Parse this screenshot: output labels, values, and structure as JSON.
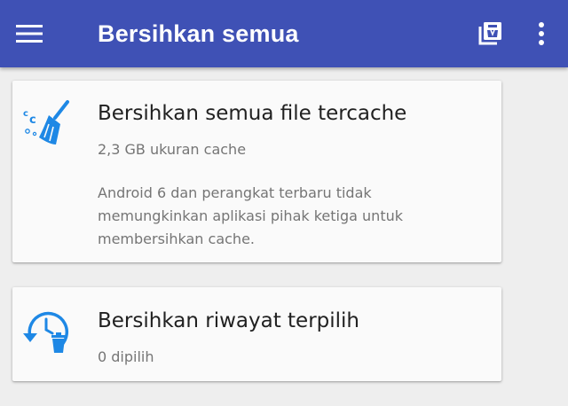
{
  "appbar": {
    "title": "Bersihkan semua",
    "background_color": "#3f51b5",
    "menu_icon": "hamburger-menu-icon",
    "action_icon": "cached-apps-list-icon",
    "overflow_icon": "more-vert-icon"
  },
  "cards": [
    {
      "icon": "broom-clean-cache-icon",
      "title": "Bersihkan semua file tercache",
      "subtitle": "2,3 GB ukuran cache",
      "description_lines": [
        "Android 6 dan perangkat terbaru tidak",
        "memungkinkan aplikasi pihak ketiga untuk",
        "membersihkan cache."
      ]
    },
    {
      "icon": "history-trash-icon",
      "title": "Bersihkan riwayat terpilih",
      "subtitle": "0 dipilih"
    }
  ],
  "colors": {
    "accent": "#1e88e5",
    "card_background": "#fafafa",
    "page_background": "#eeeeee"
  }
}
